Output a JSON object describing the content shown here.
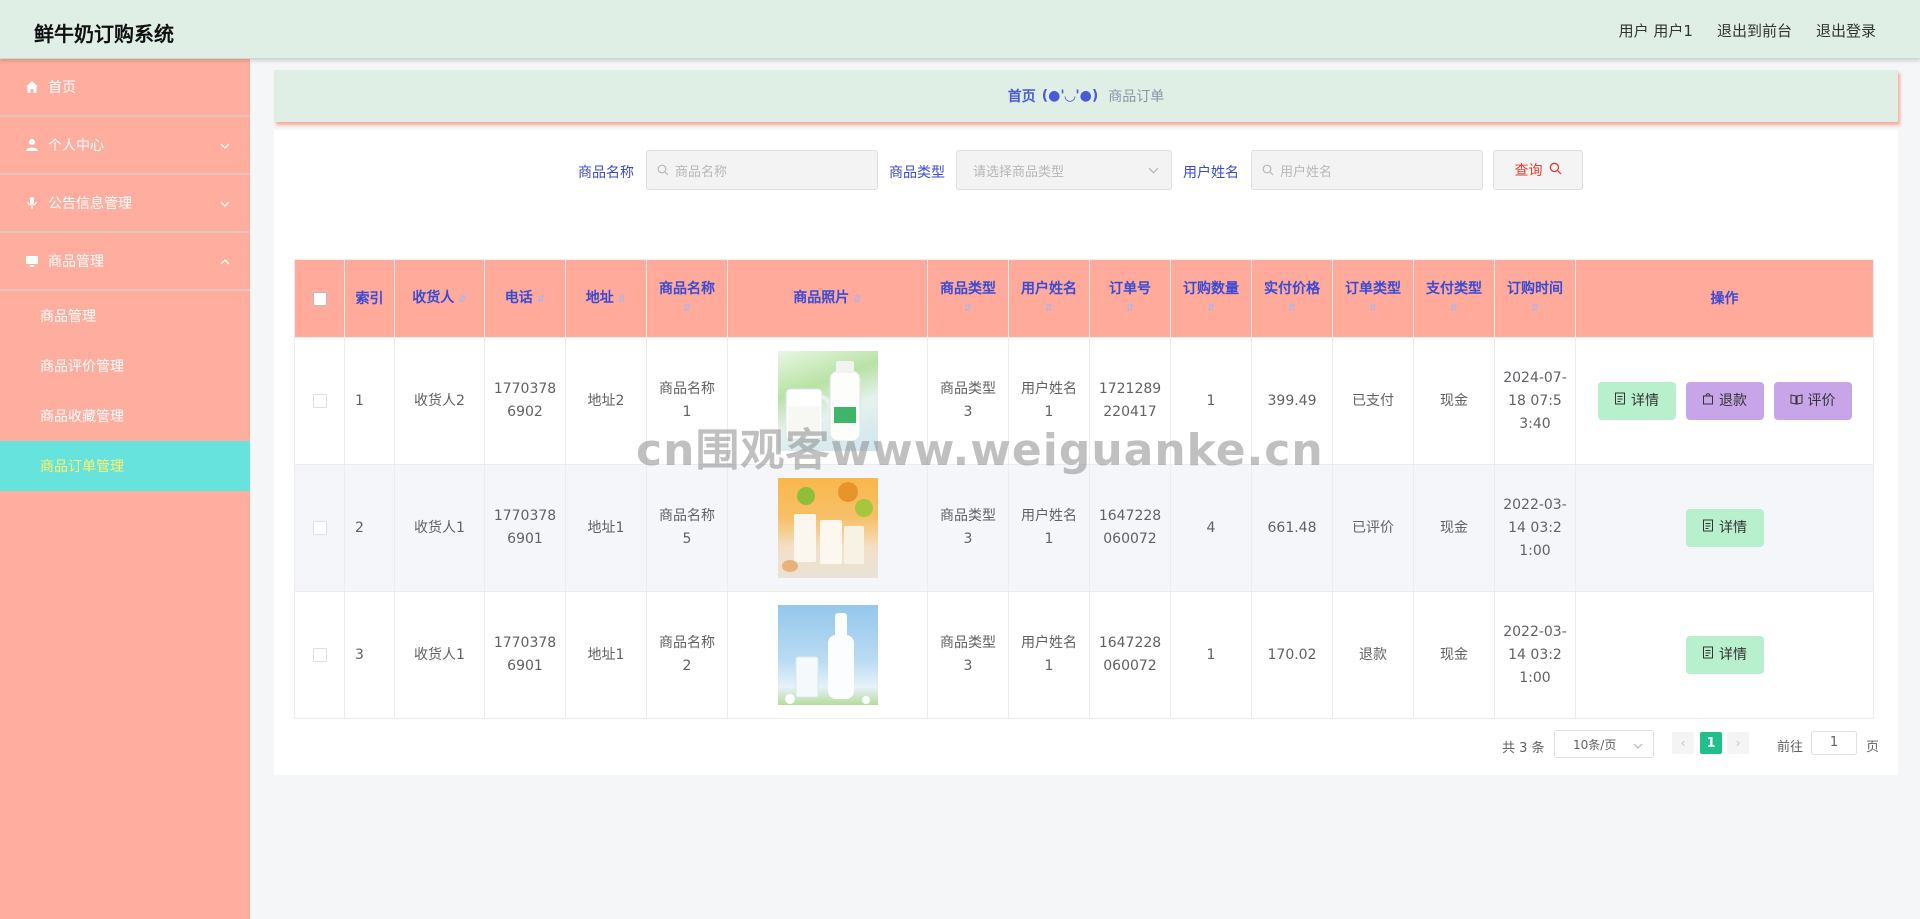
{
  "header": {
    "app_title": "鲜牛奶订购系统",
    "user_label": "用户 用户1",
    "front_label": "退出到前台",
    "logout_label": "退出登录"
  },
  "sidebar": {
    "items": [
      {
        "label": "首页",
        "icon": "home-icon"
      },
      {
        "label": "个人中心",
        "icon": "user-icon"
      },
      {
        "label": "公告信息管理",
        "icon": "microphone-icon"
      },
      {
        "label": "商品管理",
        "icon": "monitor-icon"
      }
    ],
    "subitems": [
      {
        "label": "商品管理"
      },
      {
        "label": "商品评价管理"
      },
      {
        "label": "商品收藏管理"
      },
      {
        "label": "商品订单管理",
        "active": true
      }
    ]
  },
  "breadcrumb": {
    "home": "首页",
    "face": "(●'◡'●)",
    "current": "商品订单"
  },
  "search": {
    "name_label": "商品名称",
    "name_placeholder": "商品名称",
    "type_label": "商品类型",
    "type_placeholder": "请选择商品类型",
    "user_label": "用户姓名",
    "user_placeholder": "用户姓名",
    "query_label": "查询"
  },
  "table": {
    "headers": [
      "索引",
      "收货人",
      "电话",
      "地址",
      "商品名称",
      "商品照片",
      "商品类型",
      "用户姓名",
      "订单号",
      "订购数量",
      "实付价格",
      "订单类型",
      "支付类型",
      "订购时间",
      "操作"
    ],
    "rows": [
      {
        "index": "1",
        "receiver": "收货人2",
        "phone": "17703786902",
        "address": "地址2",
        "product": "商品名称1",
        "type": "商品类型3",
        "user": "用户姓名1",
        "order_no": "1721289220417",
        "qty": "1",
        "price": "399.49",
        "order_type": "已支付",
        "pay_type": "现金",
        "time": "2024-07-18 07:53:40",
        "image": "milk-jug-bottle-photo"
      },
      {
        "index": "2",
        "receiver": "收货人1",
        "phone": "17703786901",
        "address": "地址1",
        "product": "商品名称5",
        "type": "商品类型3",
        "user": "用户姓名1",
        "order_no": "1647228060072",
        "qty": "4",
        "price": "661.48",
        "order_type": "已评价",
        "pay_type": "现金",
        "time": "2022-03-14 03:21:00",
        "image": "milk-glasses-fruit-photo"
      },
      {
        "index": "3",
        "receiver": "收货人1",
        "phone": "17703786901",
        "address": "地址1",
        "product": "商品名称2",
        "type": "商品类型3",
        "user": "用户姓名1",
        "order_no": "1647228060072",
        "qty": "1",
        "price": "170.02",
        "order_type": "退款",
        "pay_type": "现金",
        "time": "2022-03-14 03:21:00",
        "image": "milk-bottle-sky-photo"
      }
    ],
    "actions": {
      "detail": "详情",
      "refund": "退款",
      "review": "评价"
    }
  },
  "pagination": {
    "total": "共 3 条",
    "page_size": "10条/页",
    "current_page": "1",
    "goto_label": "前往",
    "goto_value": "1",
    "page_suffix": "页"
  },
  "watermark": "cn围观客www.weiguanke.cn",
  "colors": {
    "sidebar_bg": "#ffad9e",
    "header_bg": "#e0efe6",
    "active_menu_bg": "#66e3dd",
    "table_header_bg": "#ffaa9b",
    "accent_text": "#3a4ad4",
    "detail_btn": "#b8f0ce",
    "action_btn": "#c8a5e9",
    "page_active": "#1fc089"
  }
}
